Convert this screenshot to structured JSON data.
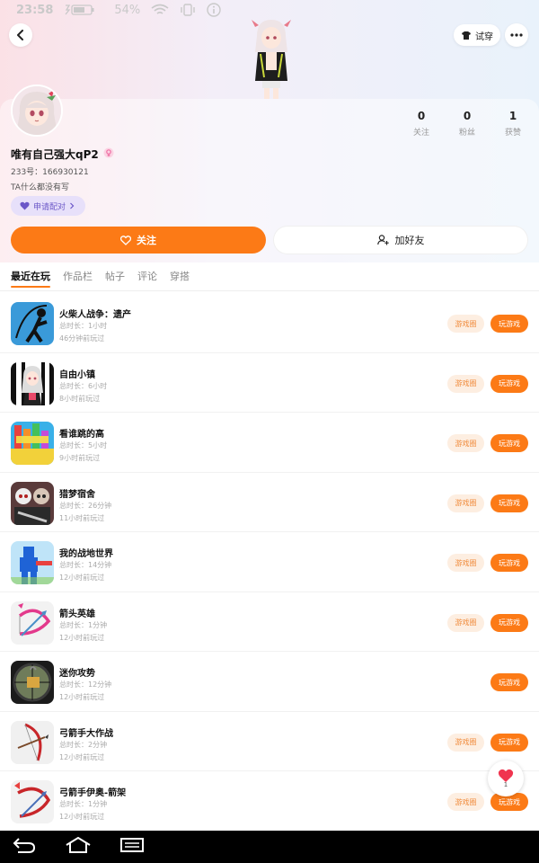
{
  "status_bar": {
    "time": "23:58",
    "battery": "54%"
  },
  "header": {
    "tryon_label": "试穿"
  },
  "profile": {
    "username": "唯有自己强大qP2",
    "uid": "233号：166930121",
    "bio": "TA什么都没有写",
    "pair_label": "申请配对",
    "stats": [
      {
        "value": "0",
        "label": "关注"
      },
      {
        "value": "0",
        "label": "粉丝"
      },
      {
        "value": "1",
        "label": "获赞"
      }
    ]
  },
  "actions": {
    "follow_label": "关注",
    "add_friend_label": "加好友"
  },
  "tabs": [
    "最近在玩",
    "作品栏",
    "帖子",
    "评论",
    "穿搭"
  ],
  "game_buttons": {
    "circle": "游戏圈",
    "play": "玩游戏"
  },
  "games": [
    {
      "name": "火柴人战争：遗产",
      "duration": "总时长：1小时",
      "last_played": "46分钟前玩过",
      "has_circle": true,
      "icon": "stickman-icon"
    },
    {
      "name": "自由小镇",
      "duration": "总时长：6小时",
      "last_played": "8小时前玩过",
      "has_circle": true,
      "icon": "anime-girl-icon"
    },
    {
      "name": "看谁跳的高",
      "duration": "总时长：5小时",
      "last_played": "9小时前玩过",
      "has_circle": true,
      "icon": "jump-icon"
    },
    {
      "name": "猎梦宿舍",
      "duration": "总时长：26分钟",
      "last_played": "11小时前玩过",
      "has_circle": true,
      "icon": "dorm-icon"
    },
    {
      "name": "我的战地世界",
      "duration": "总时长：14分钟",
      "last_played": "12小时前玩过",
      "has_circle": true,
      "icon": "blue-soldier-icon"
    },
    {
      "name": "箭头英雄",
      "duration": "总时长：1分钟",
      "last_played": "12小时前玩过",
      "has_circle": true,
      "icon": "pink-bow-icon"
    },
    {
      "name": "迷你攻势",
      "duration": "总时长：12分钟",
      "last_played": "12小时前玩过",
      "has_circle": false,
      "icon": "scope-icon"
    },
    {
      "name": "弓箭手大作战",
      "duration": "总时长：2分钟",
      "last_played": "12小时前玩过",
      "has_circle": true,
      "icon": "red-bow-icon"
    },
    {
      "name": "弓箭手伊奥-箭架",
      "duration": "总时长：1分钟",
      "last_played": "12小时前玩过",
      "has_circle": true,
      "icon": "arrow-rack-icon"
    }
  ],
  "like_fab": {
    "count": "1"
  },
  "colors": {
    "accent": "#fc7a16",
    "pair_bg": "#e7e0fa",
    "pair_text": "#6b57c8",
    "circle_bg": "#fdeee1"
  }
}
